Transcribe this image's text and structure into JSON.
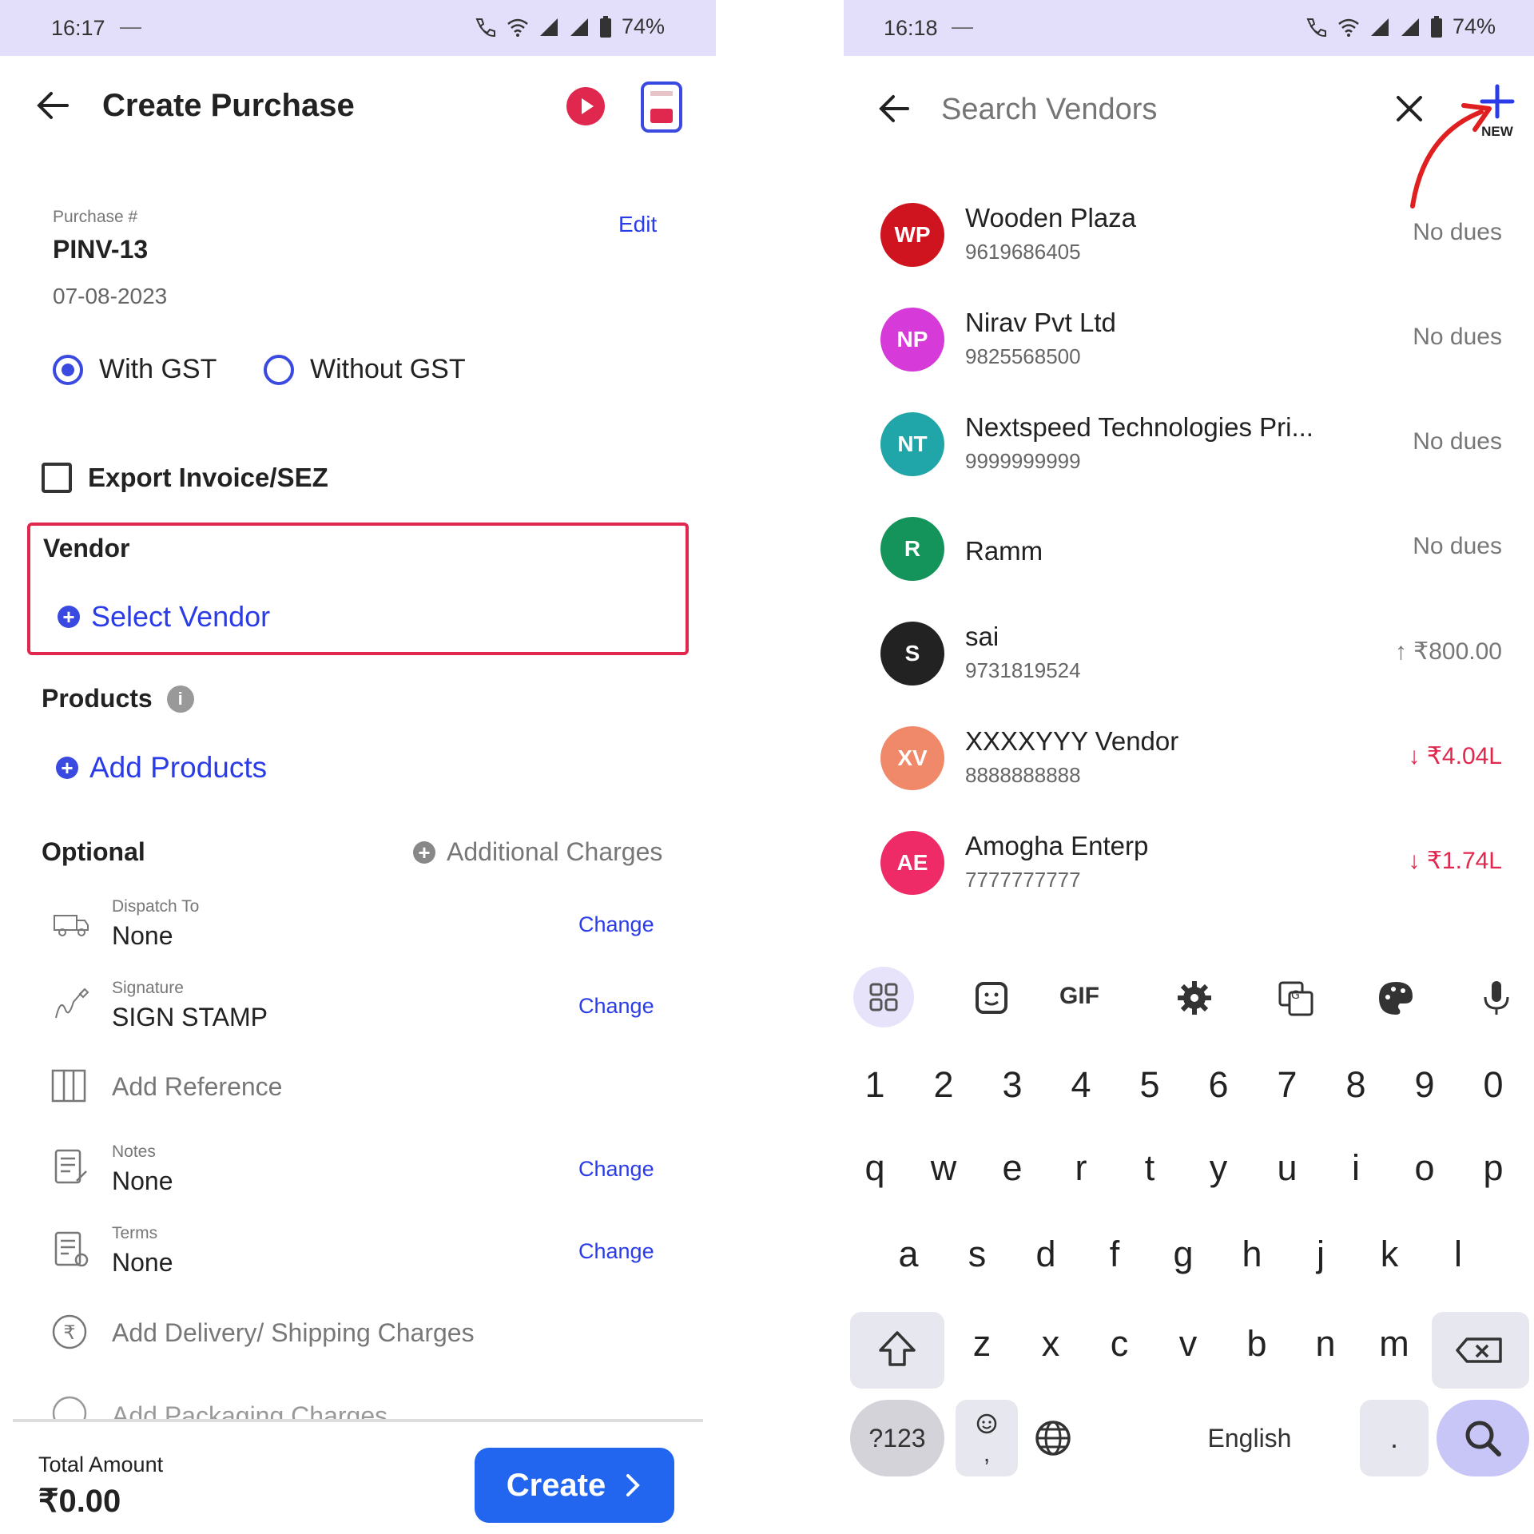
{
  "left": {
    "status": {
      "time": "16:17",
      "dash": "—",
      "battery": "74%"
    },
    "header": {
      "title": "Create Purchase"
    },
    "purchase": {
      "label": "Purchase #",
      "number": "PINV-13",
      "date": "07-08-2023",
      "edit": "Edit"
    },
    "gst": {
      "with": "With GST",
      "without": "Without GST",
      "selected": "With GST"
    },
    "export": {
      "label": "Export Invoice/SEZ",
      "checked": false
    },
    "vendor": {
      "label": "Vendor",
      "select": "Select Vendor",
      "highlight_color": "#e0284f"
    },
    "products": {
      "label": "Products",
      "add": "Add Products"
    },
    "optional": {
      "label": "Optional",
      "additional": "Additional Charges"
    },
    "rows": {
      "dispatch": {
        "label": "Dispatch To",
        "value": "None",
        "action": "Change"
      },
      "signature": {
        "label": "Signature",
        "value": "SIGN STAMP",
        "action": "Change"
      },
      "reference": {
        "value": "Add Reference"
      },
      "notes": {
        "label": "Notes",
        "value": "None",
        "action": "Change"
      },
      "terms": {
        "label": "Terms",
        "value": "None",
        "action": "Change"
      },
      "delivery": {
        "value": "Add Delivery/ Shipping Charges"
      },
      "packaging": {
        "value": "Add Packaging Charges"
      }
    },
    "footer": {
      "total_label": "Total Amount",
      "total_value": "₹0.00",
      "create": "Create"
    }
  },
  "right": {
    "status": {
      "time": "16:18",
      "dash": "—",
      "battery": "74%"
    },
    "search": {
      "placeholder": "Search Vendors",
      "new_label": "NEW"
    },
    "vendors": [
      {
        "initials": "WP",
        "name": "Wooden Plaza",
        "phone": "9619686405",
        "status": "No dues",
        "color": "#d0141f"
      },
      {
        "initials": "NP",
        "name": "Nirav Pvt Ltd",
        "phone": "9825568500",
        "status": "No dues",
        "color": "#d63ad8"
      },
      {
        "initials": "NT",
        "name": "Nextspeed Technologies Pri...",
        "phone": "9999999999",
        "status": "No dues",
        "color": "#20a6a9"
      },
      {
        "initials": "R",
        "name": "Ramm",
        "phone": "",
        "status": "No dues",
        "color": "#14945a"
      },
      {
        "initials": "S",
        "name": "sai",
        "phone": "9731819524",
        "status": "↑ ₹800.00",
        "color": "#222222"
      },
      {
        "initials": "XV",
        "name": "XXXXYYY Vendor",
        "phone": "8888888888",
        "status": "↓ ₹4.04L",
        "color": "#f0886a"
      },
      {
        "initials": "AE",
        "name": "Amogha Enterp",
        "phone": "7777777777",
        "status": "↓ ₹1.74L",
        "color": "#ee2b66"
      }
    ],
    "keyboard": {
      "toolbar": [
        "apps-icon",
        "sticker-icon",
        "GIF",
        "settings-icon",
        "translate-icon",
        "palette-icon",
        "mic-icon"
      ],
      "gif_label": "GIF",
      "numbers": [
        "1",
        "2",
        "3",
        "4",
        "5",
        "6",
        "7",
        "8",
        "9",
        "0"
      ],
      "row1": [
        "q",
        "w",
        "e",
        "r",
        "t",
        "y",
        "u",
        "i",
        "o",
        "p"
      ],
      "row2": [
        "a",
        "s",
        "d",
        "f",
        "g",
        "h",
        "j",
        "k",
        "l"
      ],
      "row3": [
        "z",
        "x",
        "c",
        "v",
        "b",
        "n",
        "m"
      ],
      "symbols": "?123",
      "comma": ",",
      "space": "English",
      "period": "."
    }
  }
}
